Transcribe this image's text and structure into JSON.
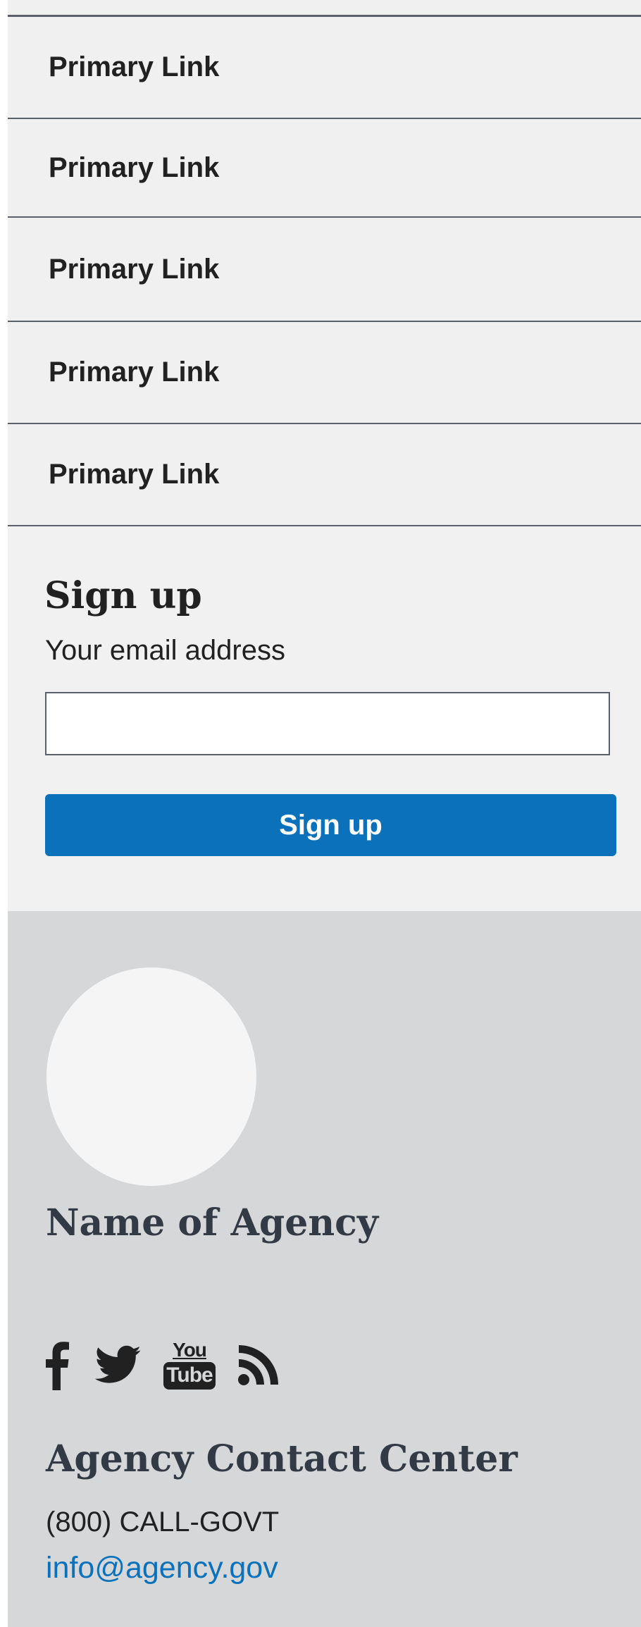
{
  "nav": {
    "items": [
      {
        "label": "Primary Link"
      },
      {
        "label": "Primary Link"
      },
      {
        "label": "Primary Link"
      },
      {
        "label": "Primary Link"
      },
      {
        "label": "Primary Link"
      }
    ]
  },
  "signup": {
    "heading": "Sign up",
    "email_label": "Your email address",
    "email_value": "",
    "button_label": "Sign up"
  },
  "footer": {
    "agency_name": "Name of Agency",
    "social_icons": [
      "facebook-icon",
      "twitter-icon",
      "youtube-icon",
      "rss-icon"
    ],
    "youtube_top": "You",
    "youtube_bottom": "Tube",
    "contact_heading": "Agency Contact Center",
    "contact_phone": "(800) CALL-GOVT",
    "contact_email": "info@agency.gov"
  },
  "colors": {
    "nav_background": "#f0f0f0",
    "divider": "#5b616b",
    "button_primary": "#0a71ba",
    "footer_background": "#d6d7d9",
    "link": "#0a71ba",
    "text": "#212121"
  }
}
